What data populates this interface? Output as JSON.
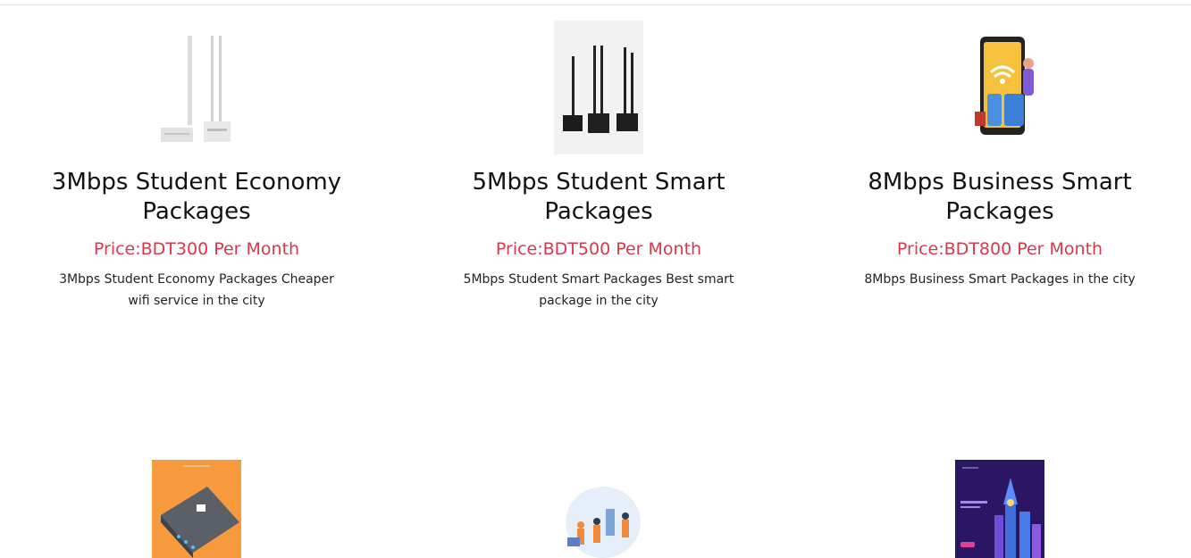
{
  "packages": [
    {
      "title": "3Mbps Student Economy Packages",
      "price": "Price:BDT300 Per Month",
      "description": "3Mbps Student Economy Packages Cheaper wifi service in the city",
      "image": "white-router-image"
    },
    {
      "title": "5Mbps Student Smart Packages",
      "price": "Price:BDT500 Per Month",
      "description": "5Mbps Student Smart Packages Best smart package in the city",
      "image": "black-router-image"
    },
    {
      "title": "8Mbps Business Smart Packages",
      "price": "Price:BDT800 Per Month",
      "description": "8Mbps Business Smart Packages in the city",
      "image": "5g-phone-image"
    }
  ],
  "second_row_images": [
    "orange-router-image",
    "people-network-image",
    "smart-city-image"
  ],
  "colors": {
    "price": "#d63a4a",
    "text": "#111111",
    "divider": "#e3e3e3"
  }
}
